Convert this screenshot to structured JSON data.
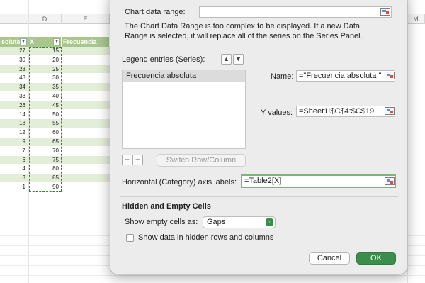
{
  "sheet": {
    "columns": [
      "D",
      "E",
      "M"
    ],
    "headers": {
      "col_c": "soluta",
      "col_d": "X",
      "col_e": "Frecuencia acum"
    },
    "filter_icon": "▾",
    "rows": [
      {
        "c": "27",
        "d": "15"
      },
      {
        "c": "30",
        "d": "20"
      },
      {
        "c": "23",
        "d": "25"
      },
      {
        "c": "43",
        "d": "30"
      },
      {
        "c": "34",
        "d": "35"
      },
      {
        "c": "33",
        "d": "40"
      },
      {
        "c": "26",
        "d": "45"
      },
      {
        "c": "14",
        "d": "50"
      },
      {
        "c": "18",
        "d": "55"
      },
      {
        "c": "12",
        "d": "60"
      },
      {
        "c": "9",
        "d": "65"
      },
      {
        "c": "7",
        "d": "70"
      },
      {
        "c": "6",
        "d": "75"
      },
      {
        "c": "4",
        "d": "80"
      },
      {
        "c": "3",
        "d": "85"
      },
      {
        "c": "1",
        "d": "90"
      }
    ]
  },
  "dialog": {
    "chart_range_label": "Chart data range:",
    "chart_range_value": "",
    "info_text": "The Chart Data Range is too complex to be displayed. If a new Data Range is selected, it will replace all of the series on the Series Panel.",
    "legend_label": "Legend entries (Series):",
    "move_up_icon": "▲",
    "move_down_icon": "▼",
    "series": [
      "Frecuencia absoluta"
    ],
    "name_label": "Name:",
    "name_value": "=\"Frecuencia absoluta \"",
    "y_values_label": "Y values:",
    "y_values_value": "=Sheet1!$C$4:$C$19",
    "add_label": "+",
    "remove_label": "−",
    "switch_label": "Switch Row/Column",
    "axis_labels_label": "Horizontal (Category) axis labels:",
    "axis_labels_value": "=Table2[X]",
    "hidden_heading": "Hidden and Empty Cells",
    "show_empty_label": "Show empty cells as:",
    "show_empty_value": "Gaps",
    "select_arrow": "↕",
    "show_hidden_label": "Show data in hidden rows and columns",
    "show_hidden_checked": false,
    "cancel_label": "Cancel",
    "ok_label": "OK"
  }
}
